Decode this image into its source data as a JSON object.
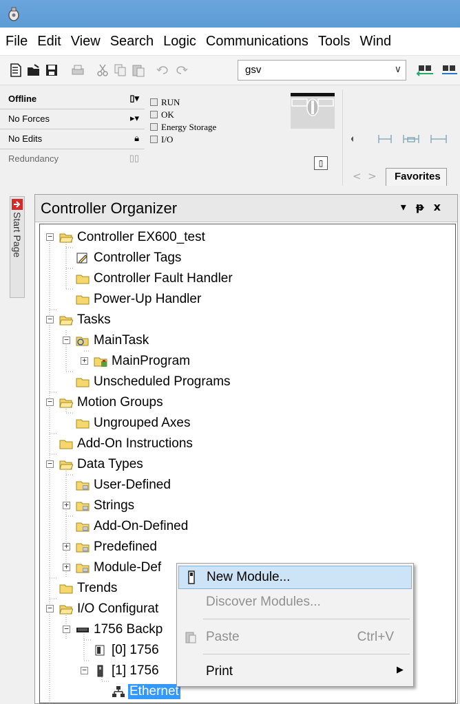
{
  "menu": [
    "File",
    "Edit",
    "View",
    "Search",
    "Logic",
    "Communications",
    "Tools",
    "Wind"
  ],
  "toolbar": {
    "search_value": "gsv"
  },
  "status": {
    "mode": "Offline",
    "forces": "No Forces",
    "edits": "No Edits",
    "redundancy": "Redundancy",
    "indicators": [
      "RUN",
      "OK",
      "Energy Storage",
      "I/O"
    ]
  },
  "favorites_tab": "Favorites",
  "start_page_tab": "Start Page",
  "organizer": {
    "title": "Controller Organizer",
    "controls": [
      "▾",
      "ᵽ",
      "x"
    ],
    "tree": [
      "Controller EX600_test",
      "Controller Tags",
      "Controller Fault Handler",
      "Power-Up Handler",
      "Tasks",
      "MainTask",
      "MainProgram",
      "Unscheduled Programs",
      "Motion Groups",
      "Ungrouped Axes",
      "Add-On Instructions",
      "Data Types",
      "User-Defined",
      "Strings",
      "Add-On-Defined",
      "Predefined",
      "Module-Def",
      "Trends",
      "I/O Configurat",
      "1756 Backp",
      "[0] 1756",
      "[1] 1756",
      "Ethernet"
    ]
  },
  "context_menu": {
    "new_module": "New Module...",
    "discover": "Discover Modules...",
    "paste": "Paste",
    "paste_shortcut": "Ctrl+V",
    "print": "Print"
  }
}
